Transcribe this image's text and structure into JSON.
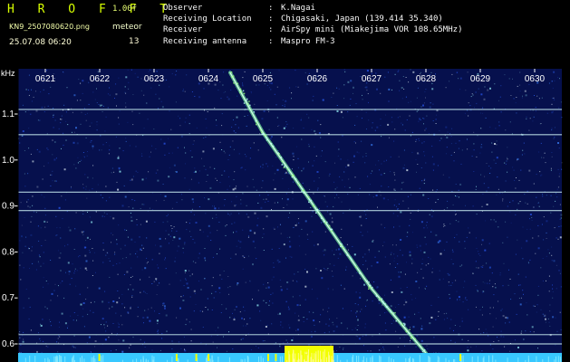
{
  "header": {
    "brand": "H R O F F T",
    "version": "1.00f",
    "file_name": "KN9_2507080620.png",
    "datetime": "25.07.08 06:20",
    "meteor_label": "meteor",
    "meteor_count": "13"
  },
  "info": [
    {
      "label": "Observer",
      "value": "K.Nagai"
    },
    {
      "label": "Receiving Location",
      "value": "Chigasaki, Japan (139.414 35.340)"
    },
    {
      "label": "Receiver",
      "value": "AirSpy mini (Miakejima VOR 108.65MHz)"
    },
    {
      "label": "Receiving antenna",
      "value": "Maspro FM-3"
    }
  ],
  "display": {
    "background_color": "#06104d",
    "noise_colors": [
      "#2f67ff",
      "#3c83ff",
      "#2d5fff",
      "#9dfcff",
      "#eefcff"
    ],
    "meteor_trail_color": "#7fffa3",
    "carrier_line_color": "#d8ffff",
    "axis_color": "#ffffff",
    "bottom_trace_color": "#38c8ff",
    "bottom_highlight_color": "#f2ff00"
  },
  "chart_data": {
    "type": "heatmap",
    "title": "",
    "xlabel": "",
    "ylabel": "kHz",
    "x": [
      "0621",
      "0622",
      "0623",
      "0624",
      "0625",
      "0626",
      "0627",
      "0628",
      "0629",
      "0630"
    ],
    "y_ticks": [
      1.1,
      1.0,
      0.9,
      0.8,
      0.7,
      0.6
    ],
    "y_tick_labels": [
      "1.1",
      "1.0",
      "0.9",
      "0.8",
      "0.7",
      "0.6"
    ],
    "y_range": [
      0.6,
      1.1
    ],
    "grid": false,
    "legend": "none",
    "horizontal_lines_khz": [
      1.11,
      1.055,
      0.93,
      0.89,
      0.62,
      0.6
    ],
    "meteor_trail": [
      {
        "time": "0624.4",
        "khz": 1.19
      },
      {
        "time": "0625.0",
        "khz": 1.06
      },
      {
        "time": "0626.0",
        "khz": 0.89
      },
      {
        "time": "0627.0",
        "khz": 0.72
      },
      {
        "time": "0628.0",
        "khz": 0.58
      }
    ],
    "bottom_highlight": [
      {
        "from": "0625.4",
        "to": "0626.3"
      }
    ]
  }
}
